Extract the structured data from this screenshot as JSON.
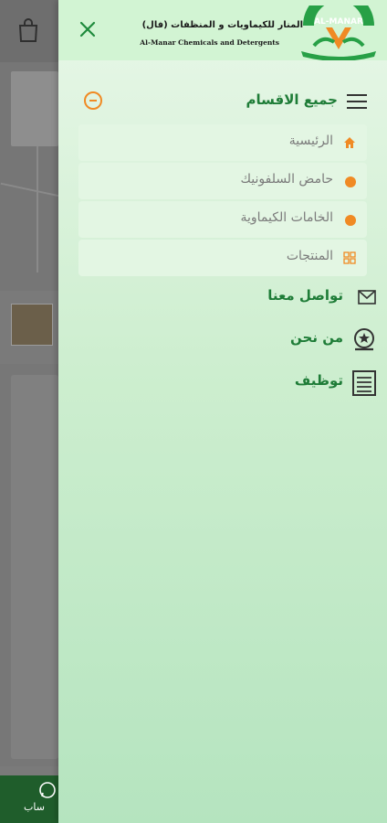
{
  "background": {
    "bottom_button_label": "ساب"
  },
  "drawer": {
    "brand": {
      "name_ar": "المنار للكيماويات و المنظفات (فال)",
      "name_en": "Al-Manar Chemicals and Detergents",
      "logo_text": "AL-MANAR"
    },
    "section_title": "جميع الاقسام",
    "sub_items": [
      {
        "label": "الرئيسية",
        "icon": "home-icon"
      },
      {
        "label": "حامض السلفونيك",
        "icon": "dot-icon"
      },
      {
        "label": "الخامات الكيماوية",
        "icon": "dot-icon"
      },
      {
        "label": "المنتجات",
        "icon": "grid-icon"
      }
    ],
    "main_items": [
      {
        "label": "تواصل معنا",
        "icon": "mail-icon"
      },
      {
        "label": "من نحن",
        "icon": "badge-icon"
      },
      {
        "label": "توظيف",
        "icon": "list-icon"
      }
    ],
    "colors": {
      "accent_green": "#1e7c37",
      "accent_orange": "#f08a24"
    }
  }
}
